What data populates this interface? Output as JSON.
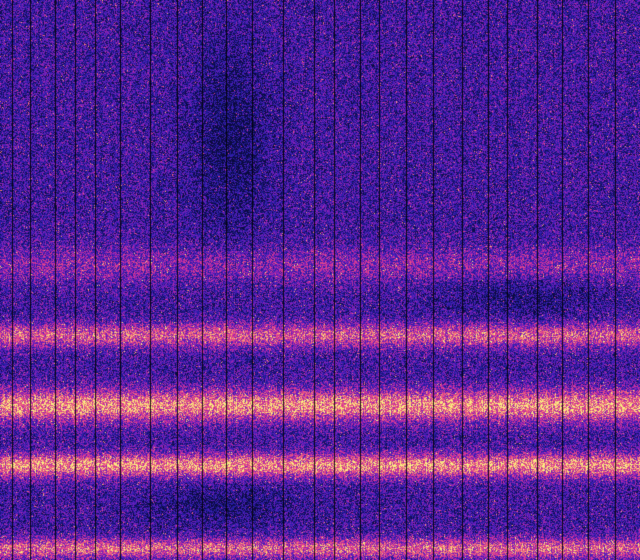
{
  "image": {
    "kind": "spectrogram",
    "colormap": "plasma-like",
    "palette": {
      "background": "#1a1aa0",
      "deep": "#0b0b5e",
      "mid": "#7a1fb8",
      "hot": "#e0408a",
      "bright": "#f5f07a"
    }
  }
}
